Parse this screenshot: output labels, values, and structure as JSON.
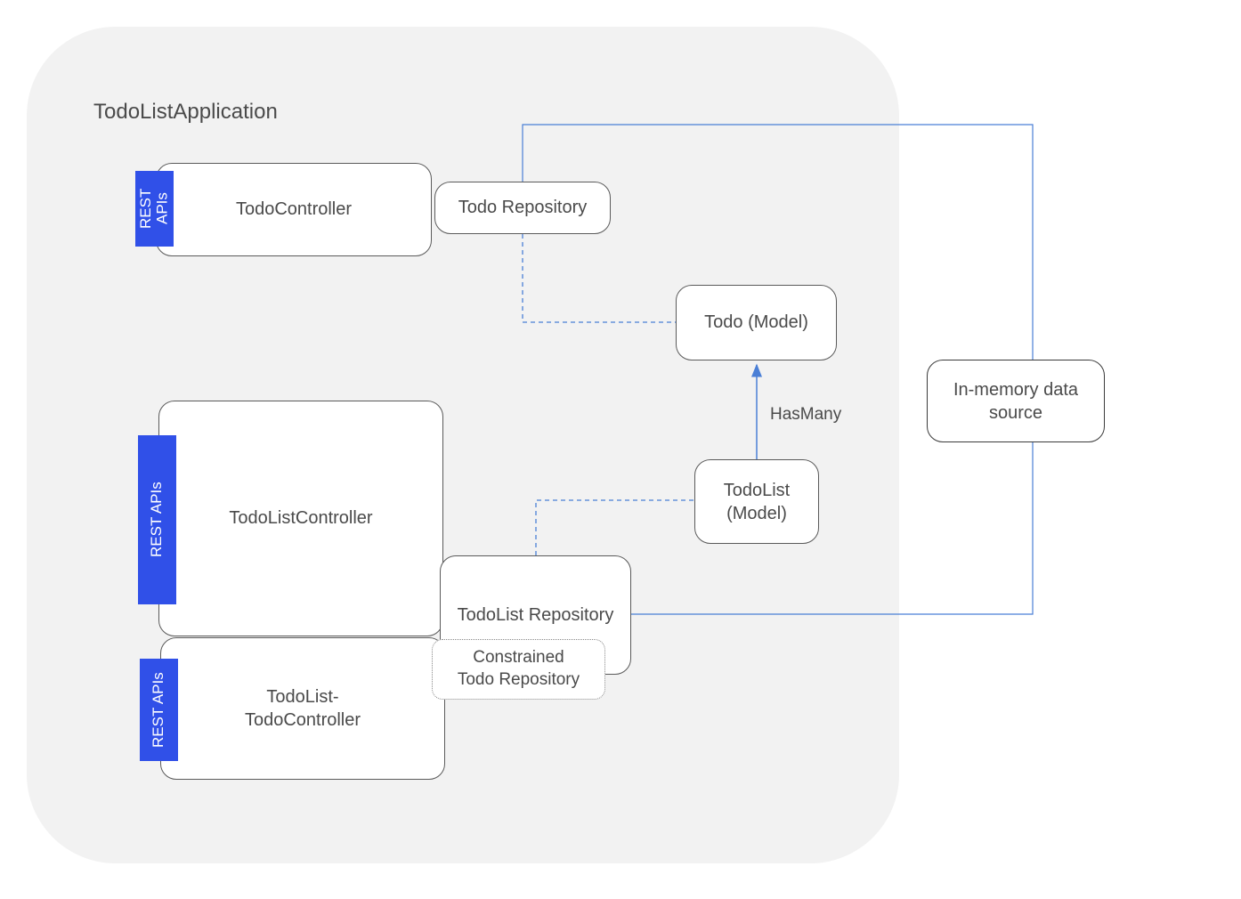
{
  "title": "TodoListApplication",
  "boxes": {
    "todo_controller": "TodoController",
    "todo_repository": "Todo Repository",
    "todo_model": "Todo (Model)",
    "todolist_controller": "TodoListController",
    "todolist_repository": "TodoList Repository",
    "todolist_model": "TodoList\n(Model)",
    "todolist_todo_controller": "TodoList-\nTodoController",
    "constrained_repo": "Constrained\nTodo Repository",
    "datasource": "In-memory data\nsource"
  },
  "badges": {
    "rest_apis": "REST\nAPIs",
    "rest_apis_tall": "REST APIs"
  },
  "labels": {
    "has_many": "HasMany"
  }
}
